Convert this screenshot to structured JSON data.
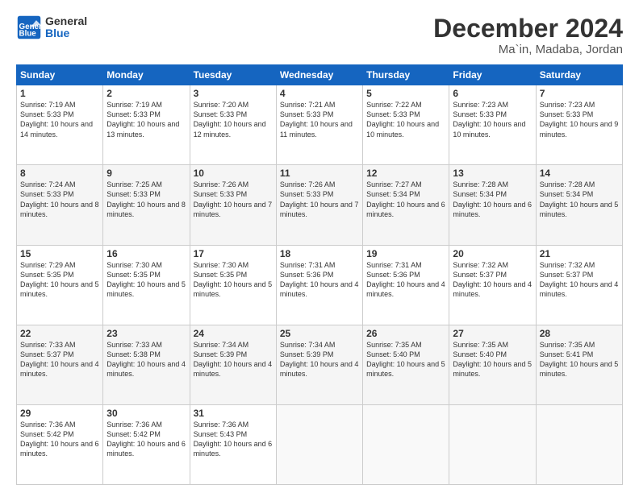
{
  "header": {
    "logo_line1": "General",
    "logo_line2": "Blue",
    "title": "December 2024",
    "subtitle": "Ma`in, Madaba, Jordan"
  },
  "calendar": {
    "days_of_week": [
      "Sunday",
      "Monday",
      "Tuesday",
      "Wednesday",
      "Thursday",
      "Friday",
      "Saturday"
    ],
    "weeks": [
      [
        null,
        null,
        null,
        null,
        null,
        null,
        null
      ]
    ]
  },
  "cells": {
    "w1": [
      {
        "num": "1",
        "info": "Sunrise: 7:19 AM\nSunset: 5:33 PM\nDaylight: 10 hours\nand 14 minutes."
      },
      {
        "num": "2",
        "info": "Sunrise: 7:19 AM\nSunset: 5:33 PM\nDaylight: 10 hours\nand 13 minutes."
      },
      {
        "num": "3",
        "info": "Sunrise: 7:20 AM\nSunset: 5:33 PM\nDaylight: 10 hours\nand 12 minutes."
      },
      {
        "num": "4",
        "info": "Sunrise: 7:21 AM\nSunset: 5:33 PM\nDaylight: 10 hours\nand 11 minutes."
      },
      {
        "num": "5",
        "info": "Sunrise: 7:22 AM\nSunset: 5:33 PM\nDaylight: 10 hours\nand 10 minutes."
      },
      {
        "num": "6",
        "info": "Sunrise: 7:23 AM\nSunset: 5:33 PM\nDaylight: 10 hours\nand 10 minutes."
      },
      {
        "num": "7",
        "info": "Sunrise: 7:23 AM\nSunset: 5:33 PM\nDaylight: 10 hours\nand 9 minutes."
      }
    ],
    "w2": [
      {
        "num": "8",
        "info": "Sunrise: 7:24 AM\nSunset: 5:33 PM\nDaylight: 10 hours\nand 8 minutes."
      },
      {
        "num": "9",
        "info": "Sunrise: 7:25 AM\nSunset: 5:33 PM\nDaylight: 10 hours\nand 8 minutes."
      },
      {
        "num": "10",
        "info": "Sunrise: 7:26 AM\nSunset: 5:33 PM\nDaylight: 10 hours\nand 7 minutes."
      },
      {
        "num": "11",
        "info": "Sunrise: 7:26 AM\nSunset: 5:33 PM\nDaylight: 10 hours\nand 7 minutes."
      },
      {
        "num": "12",
        "info": "Sunrise: 7:27 AM\nSunset: 5:34 PM\nDaylight: 10 hours\nand 6 minutes."
      },
      {
        "num": "13",
        "info": "Sunrise: 7:28 AM\nSunset: 5:34 PM\nDaylight: 10 hours\nand 6 minutes."
      },
      {
        "num": "14",
        "info": "Sunrise: 7:28 AM\nSunset: 5:34 PM\nDaylight: 10 hours\nand 5 minutes."
      }
    ],
    "w3": [
      {
        "num": "15",
        "info": "Sunrise: 7:29 AM\nSunset: 5:35 PM\nDaylight: 10 hours\nand 5 minutes."
      },
      {
        "num": "16",
        "info": "Sunrise: 7:30 AM\nSunset: 5:35 PM\nDaylight: 10 hours\nand 5 minutes."
      },
      {
        "num": "17",
        "info": "Sunrise: 7:30 AM\nSunset: 5:35 PM\nDaylight: 10 hours\nand 5 minutes."
      },
      {
        "num": "18",
        "info": "Sunrise: 7:31 AM\nSunset: 5:36 PM\nDaylight: 10 hours\nand 4 minutes."
      },
      {
        "num": "19",
        "info": "Sunrise: 7:31 AM\nSunset: 5:36 PM\nDaylight: 10 hours\nand 4 minutes."
      },
      {
        "num": "20",
        "info": "Sunrise: 7:32 AM\nSunset: 5:37 PM\nDaylight: 10 hours\nand 4 minutes."
      },
      {
        "num": "21",
        "info": "Sunrise: 7:32 AM\nSunset: 5:37 PM\nDaylight: 10 hours\nand 4 minutes."
      }
    ],
    "w4": [
      {
        "num": "22",
        "info": "Sunrise: 7:33 AM\nSunset: 5:37 PM\nDaylight: 10 hours\nand 4 minutes."
      },
      {
        "num": "23",
        "info": "Sunrise: 7:33 AM\nSunset: 5:38 PM\nDaylight: 10 hours\nand 4 minutes."
      },
      {
        "num": "24",
        "info": "Sunrise: 7:34 AM\nSunset: 5:39 PM\nDaylight: 10 hours\nand 4 minutes."
      },
      {
        "num": "25",
        "info": "Sunrise: 7:34 AM\nSunset: 5:39 PM\nDaylight: 10 hours\nand 4 minutes."
      },
      {
        "num": "26",
        "info": "Sunrise: 7:35 AM\nSunset: 5:40 PM\nDaylight: 10 hours\nand 5 minutes."
      },
      {
        "num": "27",
        "info": "Sunrise: 7:35 AM\nSunset: 5:40 PM\nDaylight: 10 hours\nand 5 minutes."
      },
      {
        "num": "28",
        "info": "Sunrise: 7:35 AM\nSunset: 5:41 PM\nDaylight: 10 hours\nand 5 minutes."
      }
    ],
    "w5": [
      {
        "num": "29",
        "info": "Sunrise: 7:36 AM\nSunset: 5:42 PM\nDaylight: 10 hours\nand 6 minutes."
      },
      {
        "num": "30",
        "info": "Sunrise: 7:36 AM\nSunset: 5:42 PM\nDaylight: 10 hours\nand 6 minutes."
      },
      {
        "num": "31",
        "info": "Sunrise: 7:36 AM\nSunset: 5:43 PM\nDaylight: 10 hours\nand 6 minutes."
      },
      null,
      null,
      null,
      null
    ]
  },
  "dow": [
    "Sunday",
    "Monday",
    "Tuesday",
    "Wednesday",
    "Thursday",
    "Friday",
    "Saturday"
  ]
}
